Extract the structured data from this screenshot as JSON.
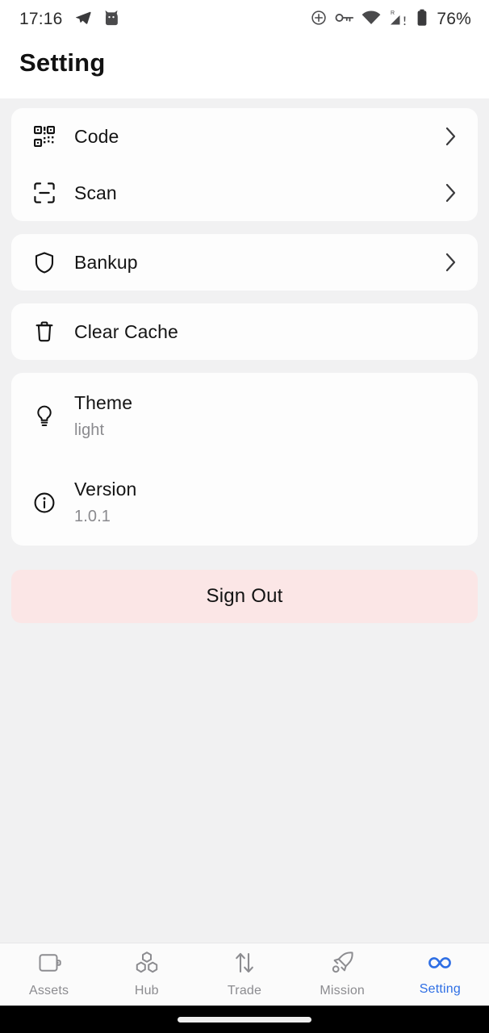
{
  "status_bar": {
    "time": "17:16",
    "battery_percent": "76%",
    "left_icons": [
      "telegram-icon",
      "cat-app-icon"
    ],
    "right_icons": [
      "location-target-icon",
      "vpn-key-icon",
      "wifi-icon",
      "cellular-signal-roaming-icon",
      "battery-icon"
    ],
    "roaming_label": "R",
    "signal_alert": "!"
  },
  "header": {
    "title": "Setting"
  },
  "groups": [
    {
      "name": "code-group",
      "rows": [
        {
          "icon": "qr-code-icon",
          "label": "Code",
          "chevron": true
        },
        {
          "icon": "scan-frame-icon",
          "label": "Scan",
          "chevron": true
        }
      ]
    },
    {
      "name": "backup-group",
      "rows": [
        {
          "icon": "shield-icon",
          "label": "Bankup",
          "chevron": true
        }
      ]
    },
    {
      "name": "cache-group",
      "rows": [
        {
          "icon": "trash-icon",
          "label": "Clear Cache",
          "chevron": false
        }
      ]
    }
  ],
  "info_group": {
    "theme": {
      "icon": "lightbulb-icon",
      "label": "Theme",
      "value": "light"
    },
    "version": {
      "icon": "info-circle-icon",
      "label": "Version",
      "value": "1.0.1"
    }
  },
  "sign_out": {
    "label": "Sign Out",
    "background_color": "#fbe6e6",
    "text_color": "#131313"
  },
  "tab_bar": {
    "active_color": "#2f6fe4",
    "inactive_color": "#8c8c90",
    "items": [
      {
        "icon": "wallet-icon",
        "label": "Assets",
        "active": false
      },
      {
        "icon": "cubes-icon",
        "label": "Hub",
        "active": false
      },
      {
        "icon": "trade-arrows-icon",
        "label": "Trade",
        "active": false
      },
      {
        "icon": "rocket-icon",
        "label": "Mission",
        "active": false
      },
      {
        "icon": "infinity-icon",
        "label": "Setting",
        "active": true
      }
    ]
  }
}
